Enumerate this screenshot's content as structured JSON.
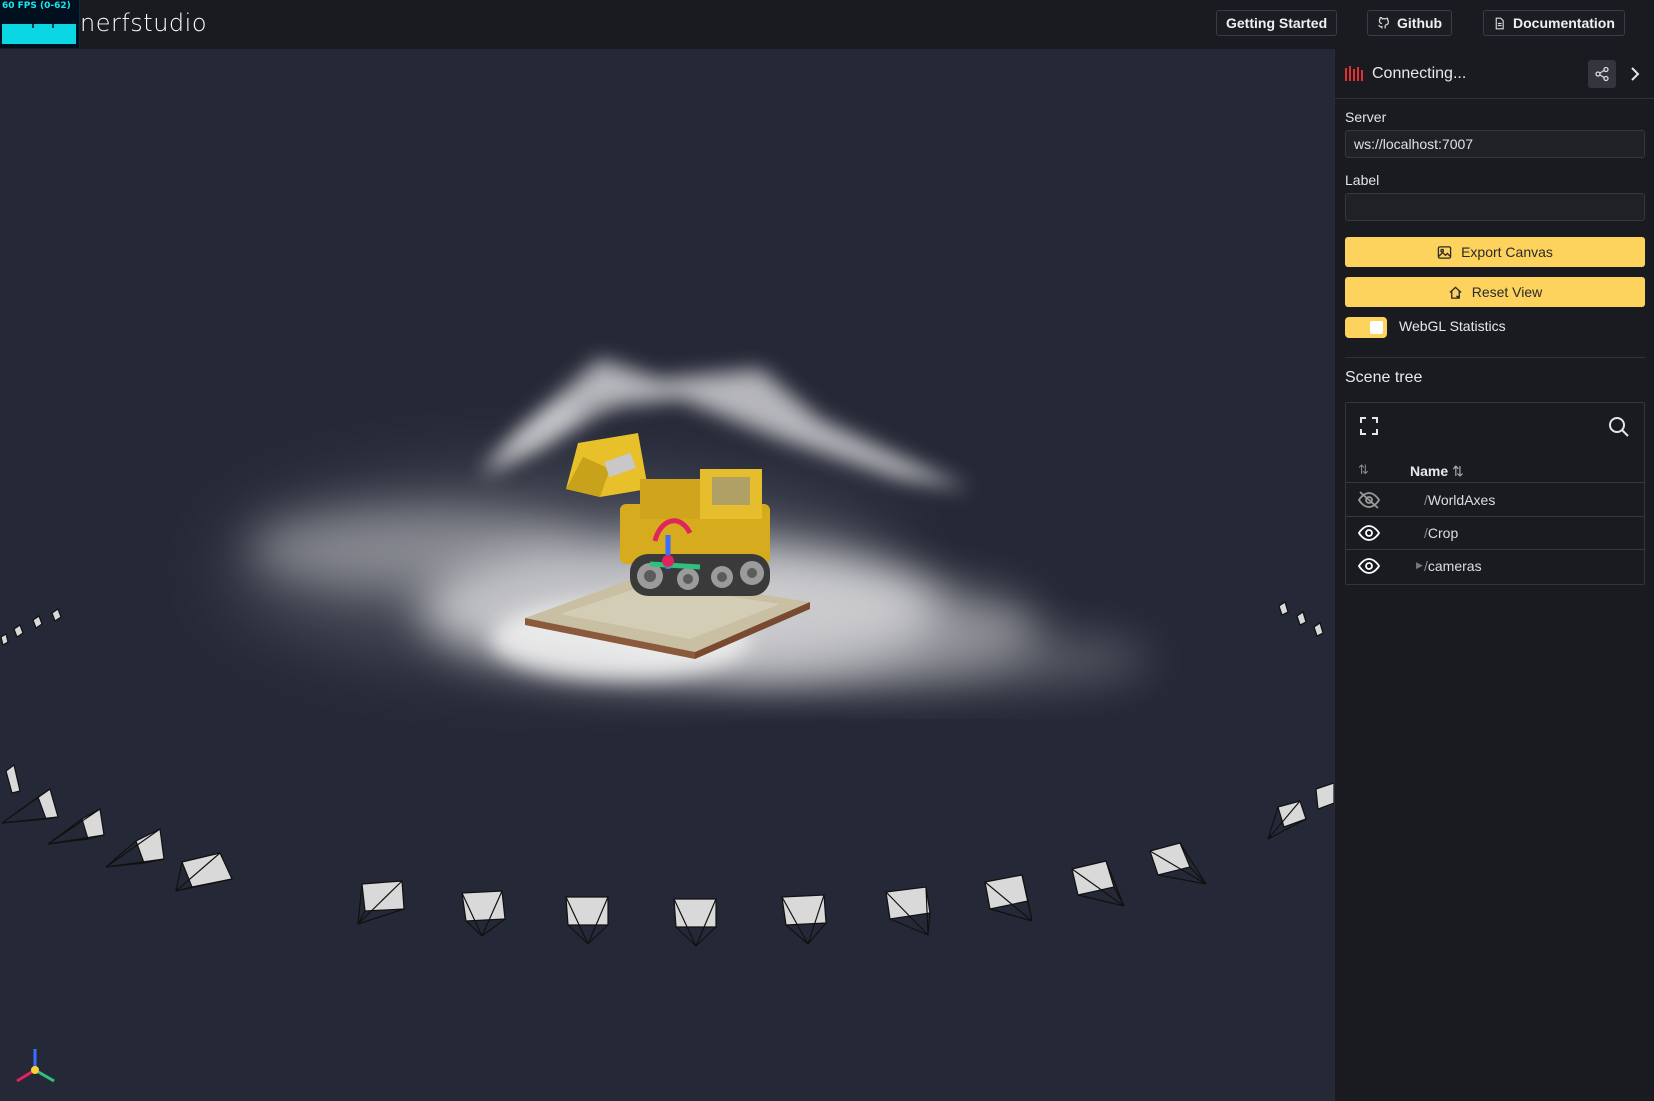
{
  "fps": {
    "label": "60 FPS (0-62)"
  },
  "header": {
    "logo": "nerfstudio",
    "buttons": [
      {
        "label": "Getting Started",
        "icon": "none"
      },
      {
        "label": "Github",
        "icon": "github-icon"
      },
      {
        "label": "Documentation",
        "icon": "document-icon"
      }
    ]
  },
  "panel": {
    "status": "Connecting...",
    "status_color": "#e03131",
    "server_label": "Server",
    "server_value": "ws://localhost:7007",
    "label_label": "Label",
    "label_value": "",
    "export_label": "Export Canvas",
    "reset_label": "Reset View",
    "webgl_label": "WebGL Statistics",
    "webgl_enabled": true,
    "scene_tree_title": "Scene tree",
    "tree_header": "Name",
    "tree_rows": [
      {
        "name": "WorldAxes",
        "visible": false,
        "expandable": false
      },
      {
        "name": "Crop",
        "visible": true,
        "expandable": false
      },
      {
        "name": "cameras",
        "visible": true,
        "expandable": true
      }
    ]
  },
  "colors": {
    "accent": "#fdd35e",
    "background": "#252836",
    "panel": "#1a1b20"
  }
}
